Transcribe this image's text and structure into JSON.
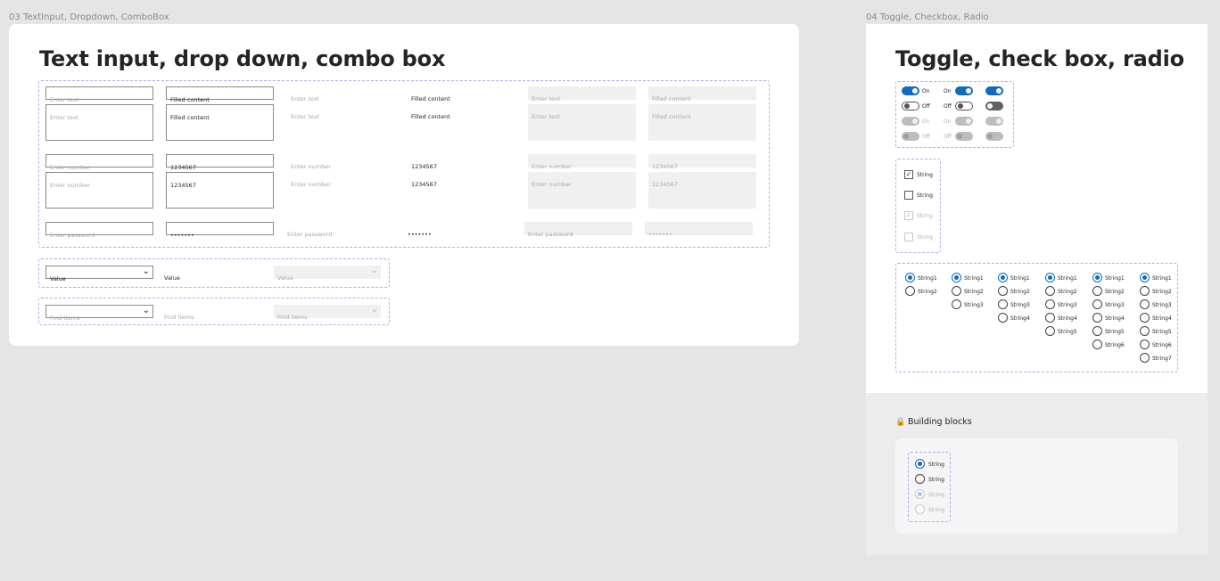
{
  "frames": {
    "left_label": "03 TextInput, Dropdown, ComboBox",
    "right_label": "04 Toggle, Checkbox, Radio"
  },
  "text_inputs": {
    "title": "Text input, drop down, combo box",
    "placeholder_text": "Enter text",
    "filled_text": "Filled content",
    "placeholder_number": "Enter number",
    "filled_number": "1234567",
    "placeholder_password": "Enter password",
    "filled_password": "•••••••"
  },
  "dropdowns": {
    "value": "Value",
    "find": "Find items"
  },
  "toggles": {
    "title": "Toggle, check box, radio",
    "on_label": "On",
    "off_label": "Off"
  },
  "checkboxes": {
    "label": "String"
  },
  "radios": {
    "groups": [
      [
        "String1",
        "String2"
      ],
      [
        "String1",
        "String2",
        "String3"
      ],
      [
        "String1",
        "String2",
        "String3",
        "String4"
      ],
      [
        "String1",
        "String2",
        "String3",
        "String4",
        "String5"
      ],
      [
        "String1",
        "String2",
        "String3",
        "String4",
        "String5",
        "String6"
      ],
      [
        "String1",
        "String2",
        "String3",
        "String4",
        "String5",
        "String6",
        "String7"
      ]
    ]
  },
  "building_blocks": {
    "title": "Building blocks",
    "icon": "lock-icon",
    "radio_label": "String"
  },
  "colors": {
    "accent": "#0f6cbd",
    "dashed_border": "#b7a9ee",
    "canvas": "#e5e5e5"
  }
}
